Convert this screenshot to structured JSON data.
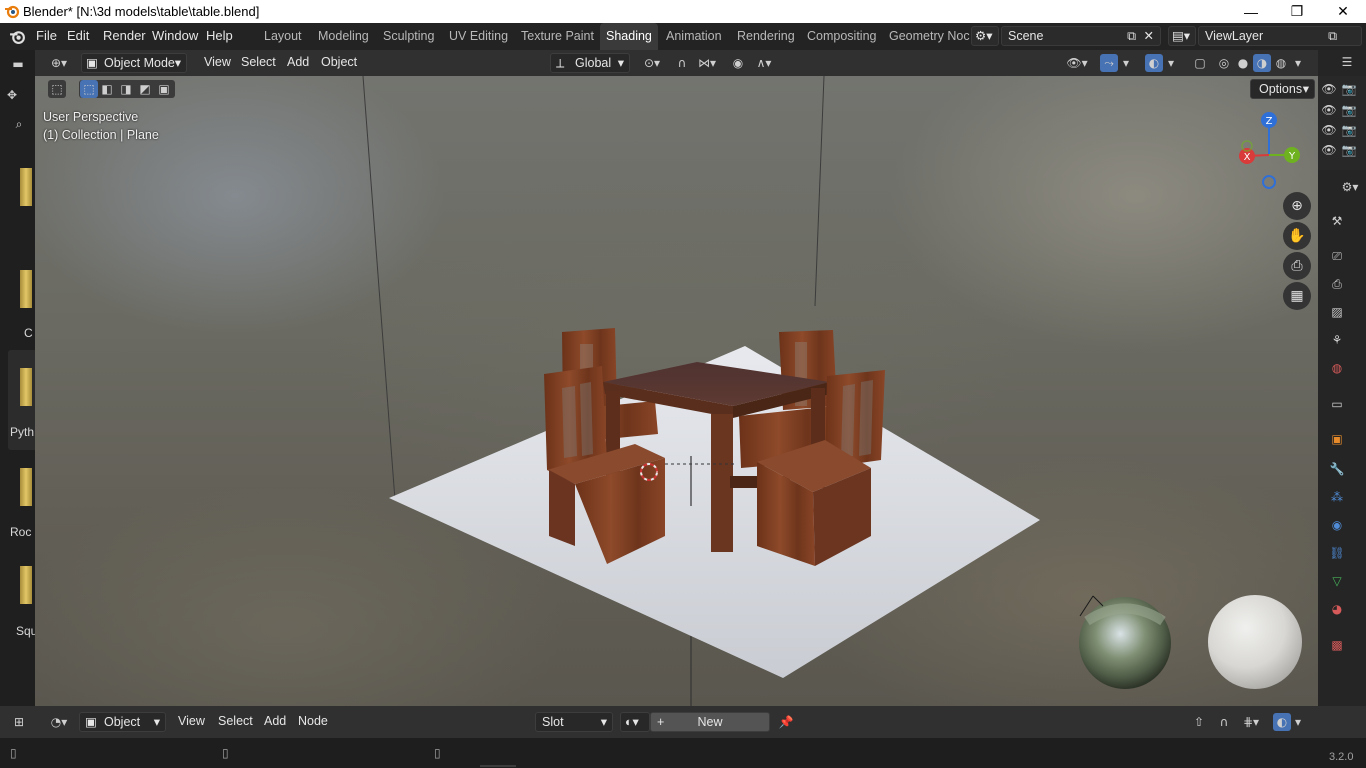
{
  "window": {
    "title": "Blender* [N:\\3d models\\table\\table.blend]",
    "controls": [
      "—",
      "❐",
      "✕"
    ]
  },
  "menubar": {
    "items": [
      "File",
      "Edit",
      "Render",
      "Window",
      "Help"
    ]
  },
  "workspaces": {
    "tabs": [
      "Layout",
      "Modeling",
      "Sculpting",
      "UV Editing",
      "Texture Paint",
      "Shading",
      "Animation",
      "Rendering",
      "Compositing",
      "Geometry Noc"
    ],
    "active": "Shading"
  },
  "scene": {
    "name": "Scene",
    "view_layer": "ViewLayer"
  },
  "viewport_header": {
    "mode": "Object Mode",
    "menus": [
      "View",
      "Select",
      "Add",
      "Object"
    ],
    "transform_orientation": "Global",
    "options_label": "Options"
  },
  "viewport": {
    "perspective_label": "User Perspective",
    "collection_label": "(1) Collection | Plane",
    "gizmo_axes": [
      "X",
      "Y",
      "Z"
    ]
  },
  "left_panel": {
    "labels": [
      "C",
      "Pyth",
      "Roc",
      "Squ"
    ]
  },
  "bottom_header": {
    "object_dropdown": "Object",
    "menus": [
      "View",
      "Select",
      "Add",
      "Node"
    ],
    "slot_dropdown": "Slot",
    "new_button": "New"
  },
  "statusbar": {
    "version": "3.2.0"
  },
  "colors": {
    "accent_blue": "#4772b3",
    "wood": "#7a3d22",
    "floor": "#d7d9de"
  },
  "icons": [
    "blender-logo-icon",
    "editor-type-icon",
    "cursor-icon",
    "search-icon",
    "zoom-icon",
    "hand-icon",
    "camera-icon",
    "grid-icon",
    "eye-icon",
    "render-icon",
    "wrench-icon",
    "world-icon",
    "pin-icon"
  ]
}
